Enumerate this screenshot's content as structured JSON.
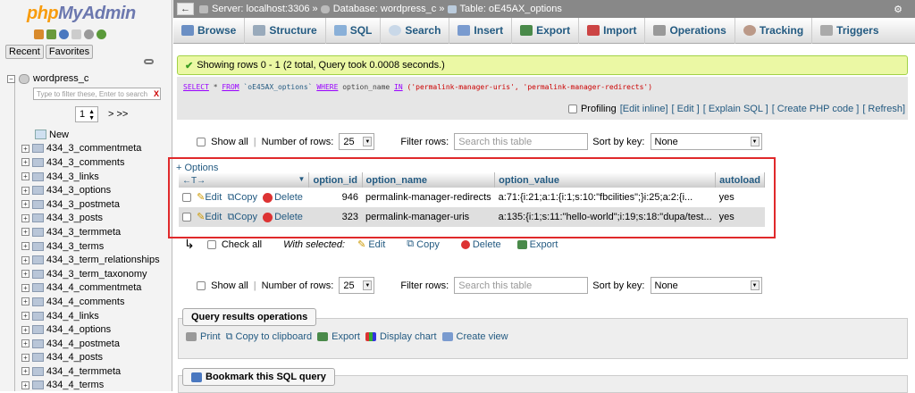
{
  "sidebar": {
    "logo_php": "php",
    "logo_my": "MyAdmin",
    "tab_recent": "Recent",
    "tab_favorites": "Favorites",
    "db_name": "wordpress_c",
    "filter_placeholder": "Type to filter these, Enter to search",
    "filter_clear": "X",
    "page_value": "1",
    "page_next": "> >>",
    "new_label": "New",
    "tables": [
      "434_3_commentmeta",
      "434_3_comments",
      "434_3_links",
      "434_3_options",
      "434_3_postmeta",
      "434_3_posts",
      "434_3_termmeta",
      "434_3_terms",
      "434_3_term_relationships",
      "434_3_term_taxonomy",
      "434_4_commentmeta",
      "434_4_comments",
      "434_4_links",
      "434_4_options",
      "434_4_postmeta",
      "434_4_posts",
      "434_4_termmeta",
      "434_4_terms"
    ]
  },
  "breadcrumb": {
    "back": "←",
    "server": "Server: localhost:3306",
    "sep": "»",
    "database": "Database: wordpress_c",
    "table": "Table: oE45AX_options"
  },
  "menu": {
    "browse": "Browse",
    "structure": "Structure",
    "sql": "SQL",
    "search": "Search",
    "insert": "Insert",
    "export": "Export",
    "import": "Import",
    "operations": "Operations",
    "tracking": "Tracking",
    "triggers": "Triggers"
  },
  "message": {
    "success": "Showing rows 0 - 1 (2 total, Query took 0.0008 seconds.)"
  },
  "sql": {
    "select": "SELECT",
    "star_from": " * ",
    "from": "FROM",
    "table": " `oE45AX_options` ",
    "where": "WHERE",
    "col": " option_name ",
    "in": "IN",
    "values": " ('permalink-manager-uris', 'permalink-manager-redirects')"
  },
  "profiling": {
    "label": "Profiling",
    "edit_inline": "[Edit inline]",
    "edit": "[ Edit ]",
    "explain": "[ Explain SQL ]",
    "php": "[ Create PHP code ]",
    "refresh": "[ Refresh]"
  },
  "nav": {
    "show_all": "Show all",
    "num_rows_label": "Number of rows:",
    "num_rows": "25",
    "filter_label": "Filter rows:",
    "filter_placeholder": "Search this table",
    "sort_label": "Sort by key:",
    "sort_value": "None"
  },
  "results": {
    "options_link": "+ Options",
    "columns": [
      "option_id",
      "option_name",
      "option_value",
      "autoload"
    ],
    "edit": "Edit",
    "copy": "Copy",
    "delete": "Delete",
    "rows": [
      {
        "option_id": "946",
        "option_name": "permalink-manager-redirects",
        "option_value": "a:71:{i:21;a:1:{i:1;s:10:\"fbcilities\";}i:25;a:2:{i...",
        "autoload": "yes"
      },
      {
        "option_id": "323",
        "option_name": "permalink-manager-uris",
        "option_value": "a:135:{i:1;s:11:\"hello-world\";i:19;s:18:\"dupa/test...",
        "autoload": "yes"
      }
    ]
  },
  "bulk": {
    "check_all": "Check all",
    "with_selected": "With selected:",
    "edit": "Edit",
    "copy": "Copy",
    "delete": "Delete",
    "export": "Export"
  },
  "qro": {
    "title": "Query results operations",
    "print": "Print",
    "copy": "Copy to clipboard",
    "export": "Export",
    "chart": "Display chart",
    "view": "Create view"
  },
  "bookmark": {
    "title": "Bookmark this SQL query"
  }
}
